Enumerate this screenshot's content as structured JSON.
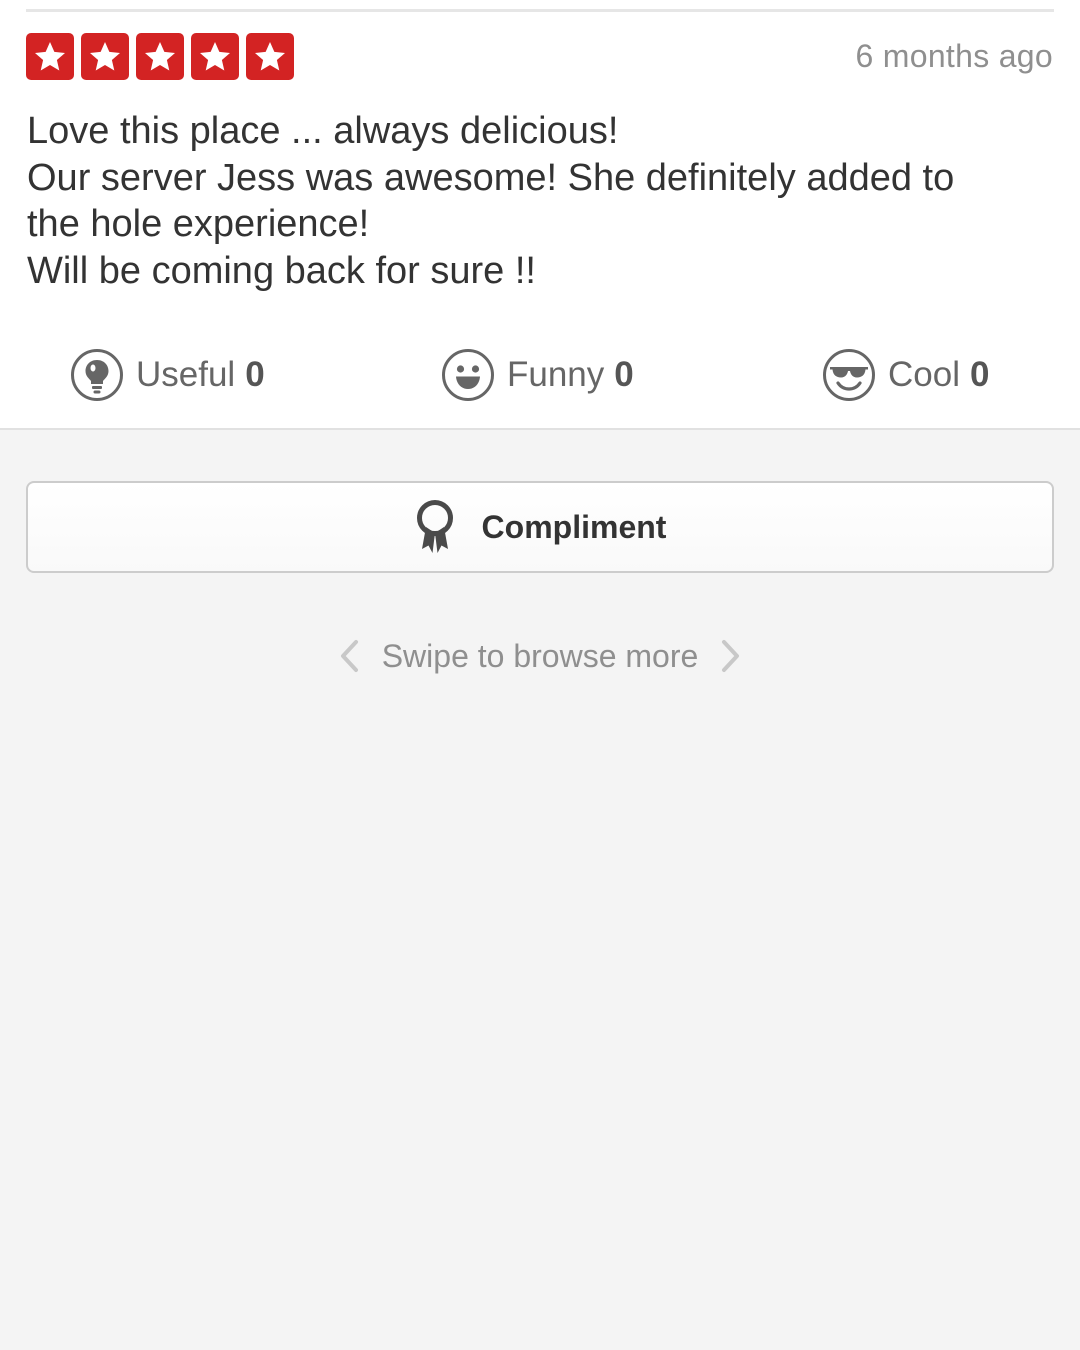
{
  "review": {
    "rating": 5,
    "rating_max": 5,
    "star_color": "#d32323",
    "timestamp": "6 months ago",
    "text_lines": [
      "Love this place ... always delicious!",
      "Our server Jess was awesome! She definitely added to",
      "the hole experience!",
      "Will be coming back for sure !!"
    ]
  },
  "reactions": [
    {
      "label": "Useful",
      "count": "0",
      "icon": "lightbulb-icon"
    },
    {
      "label": "Funny",
      "count": "0",
      "icon": "smiley-icon"
    },
    {
      "label": "Cool",
      "count": "0",
      "icon": "sunglasses-icon"
    }
  ],
  "compliment": {
    "label": "Compliment",
    "icon": "ribbon-award-icon"
  },
  "swipe": {
    "label": "Swipe to browse more",
    "left_icon": "chevron-left-icon",
    "right_icon": "chevron-right-icon"
  }
}
